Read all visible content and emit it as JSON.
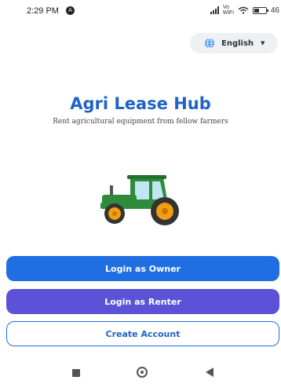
{
  "status_bar": {
    "time": "2:29 PM",
    "notification_glyph": "A",
    "volte_label": "Vo\nWiFi",
    "battery_text": "46",
    "battery_level": 0.46
  },
  "language": {
    "selected": "English",
    "icon": "globe-icon",
    "caret": "chevron-down-icon"
  },
  "app": {
    "title": "Agri Lease Hub",
    "subtitle": "Rent agricultural equipment from fellow farmers",
    "illustration": "tractor-icon"
  },
  "actions": {
    "owner_label": "Login as Owner",
    "renter_label": "Login as Renter",
    "create_label": "Create Account"
  },
  "colors": {
    "primary_blue": "#1f6fe3",
    "renter_purple": "#5b52d8",
    "title_blue": "#1f63c6",
    "tractor_green": "#2e8b3a",
    "wheel_orange": "#f29d12"
  },
  "nav_bar": {
    "icons": [
      "recent-apps-icon",
      "home-icon",
      "back-icon"
    ]
  }
}
